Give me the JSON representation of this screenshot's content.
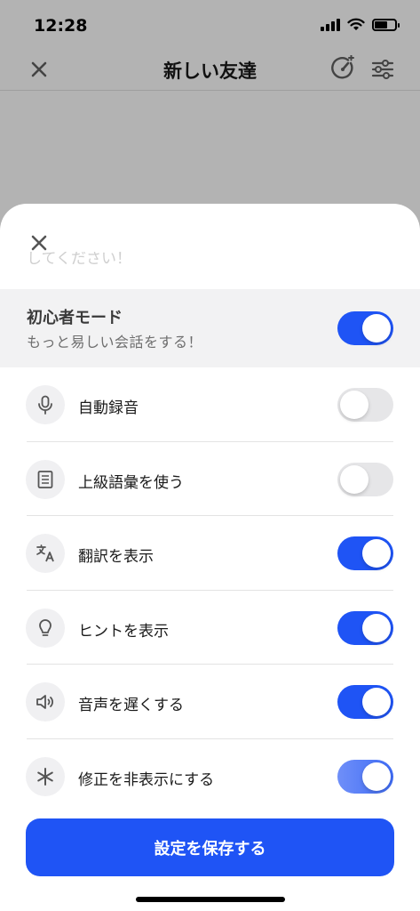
{
  "status_bar": {
    "time": "12:28"
  },
  "nav": {
    "title": "新しい友達"
  },
  "sheet": {
    "partial_text": "してください！",
    "beginner": {
      "title": "初心者モード",
      "subtitle": "もっと易しい会話をする！",
      "enabled": true
    },
    "settings": [
      {
        "icon": "microphone-icon",
        "label": "自動録音",
        "enabled": false
      },
      {
        "icon": "document-icon",
        "label": "上級語彙を使う",
        "enabled": false
      },
      {
        "icon": "translate-icon",
        "label": "翻訳を表示",
        "enabled": true
      },
      {
        "icon": "lightbulb-icon",
        "label": "ヒントを表示",
        "enabled": true
      },
      {
        "icon": "speaker-icon",
        "label": "音声を遅くする",
        "enabled": true
      },
      {
        "icon": "asterisk-icon",
        "label": "修正を非表示にする",
        "enabled": true
      }
    ],
    "save_label": "設定を保存する"
  },
  "colors": {
    "accent": "#1f54f5",
    "toggle_off": "#e6e6e8",
    "overlay": "#b3b3b3"
  }
}
